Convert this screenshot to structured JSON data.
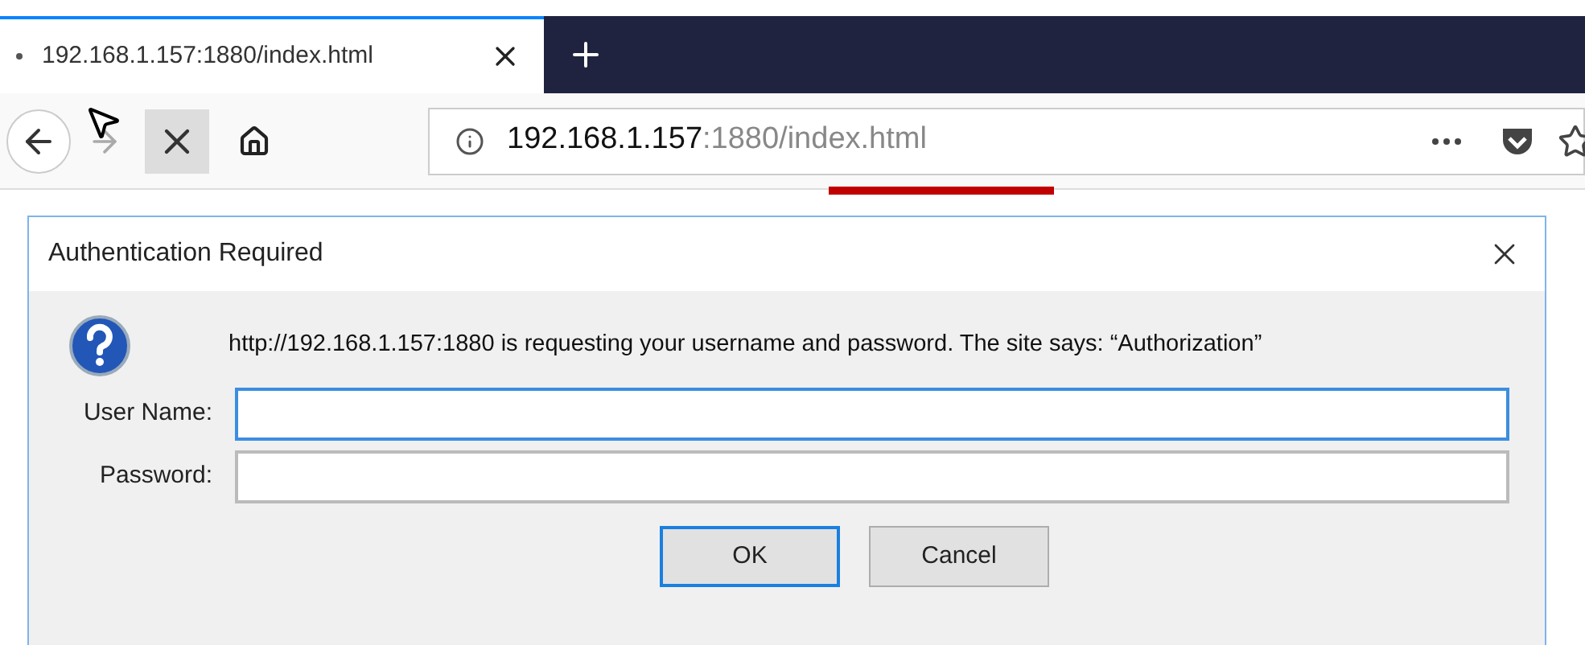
{
  "tab": {
    "title": "192.168.1.157:1880/index.html",
    "selected": true
  },
  "address_bar": {
    "host": "192.168.1.157",
    "path": ":1880/index.html"
  },
  "dialog": {
    "title": "Authentication Required",
    "message": "http://192.168.1.157:1880 is requesting your username and password. The site says: “Authorization”",
    "fields": [
      {
        "label": "User Name:",
        "focused": true
      },
      {
        "label": "Password:",
        "focused": false
      }
    ],
    "buttons": [
      {
        "label": "OK",
        "default": true
      },
      {
        "label": "Cancel",
        "default": false
      }
    ]
  }
}
